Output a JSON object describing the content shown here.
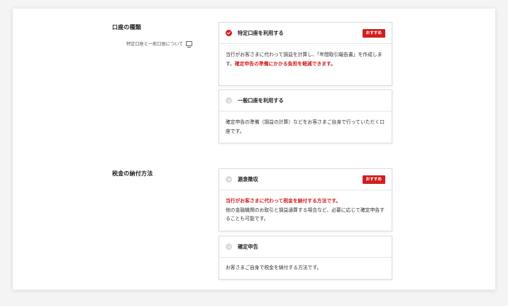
{
  "account_section": {
    "label": "口座の種類",
    "help_link": "特定口座と一般口座について",
    "cards": [
      {
        "title": "特定口座を利用する",
        "badge": "おすすめ",
        "selected": true,
        "body_plain": "当行がお客さまに代わって損益を計算し、「年間取引報告書」を作成します。",
        "body_highlight": "確定申告の準備にかかる負担を軽減できます。"
      },
      {
        "title": "一般口座を利用する",
        "selected": false,
        "body_plain": "確定申告の準備（損益の計算）などをお客さまご自身で行っていただく口座です。"
      }
    ]
  },
  "tax_section": {
    "label": "税金の納付方法",
    "cards": [
      {
        "title": "源泉徴収",
        "badge": "おすすめ",
        "selected": false,
        "body_highlight": "当行がお客さまに代わって税金を納付する方法です。",
        "body_plain": "他の金融機関のお取引と損益通算する場合など、必要に応じて確定申告することも可能です。"
      },
      {
        "title": "確定申告",
        "selected": false,
        "body_plain": "お客さまご自身で税金を納付する方法です。"
      }
    ]
  },
  "colors": {
    "accent": "#d21e1e",
    "border": "#dcdcdc",
    "background": "#f4f4f4"
  }
}
